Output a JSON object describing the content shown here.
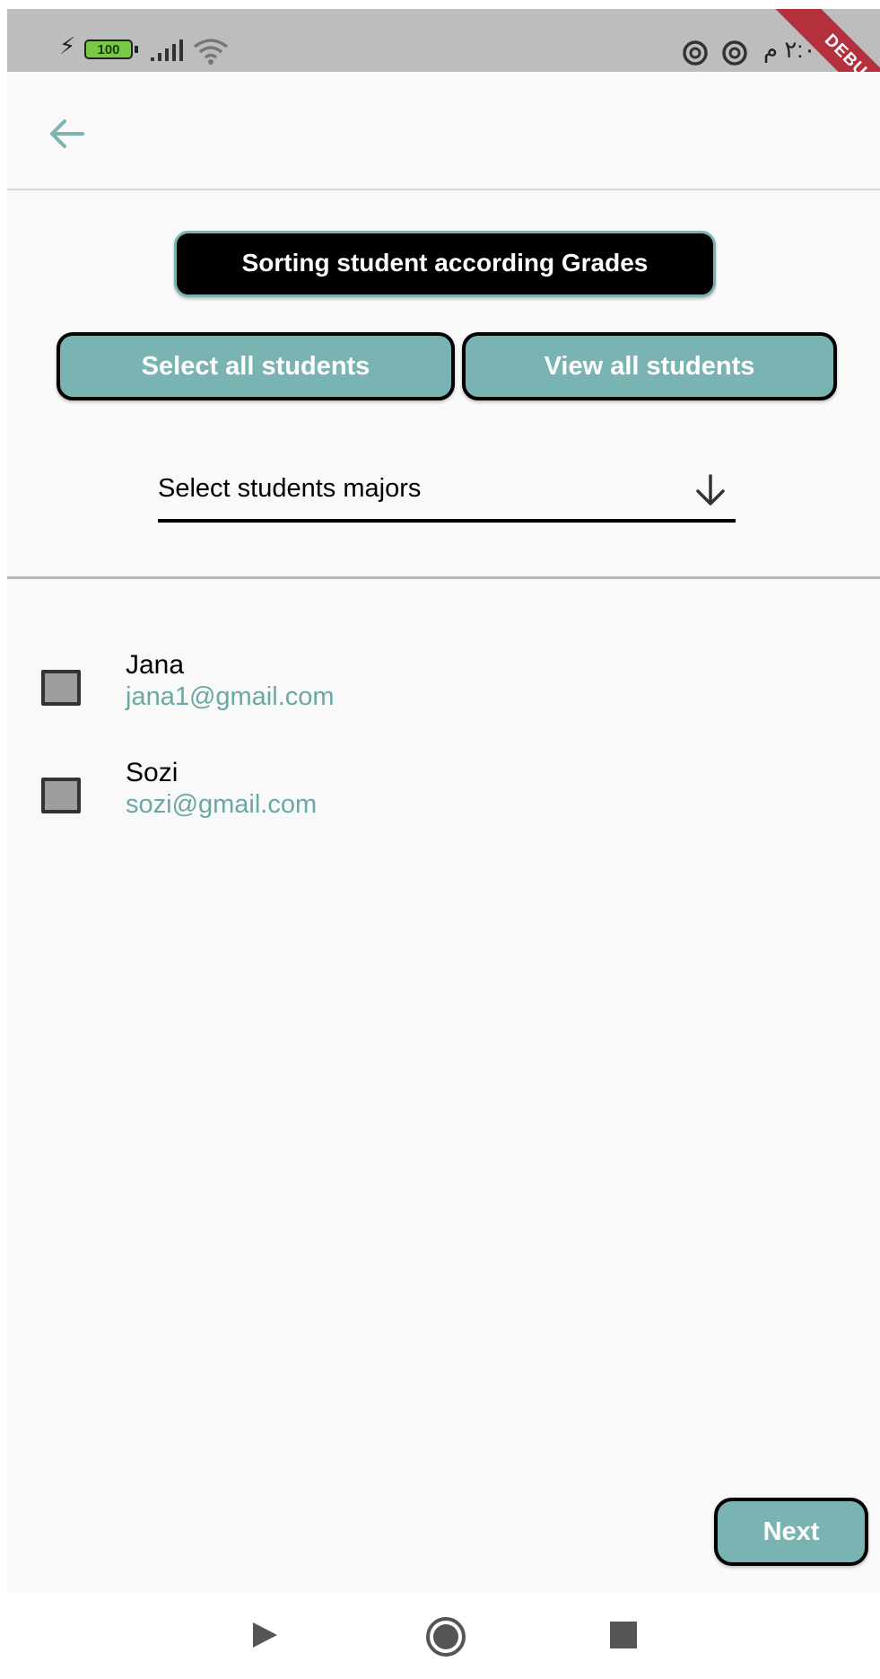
{
  "status_bar": {
    "battery": "100",
    "clock": "٢:٠٩ م",
    "debug_banner": "DEBUG"
  },
  "header": {
    "back_icon": "arrow-left-icon"
  },
  "actions": {
    "sort_label": "Sorting student according Grades",
    "select_all_label": "Select all students",
    "view_all_label": "View all students"
  },
  "majors_dropdown": {
    "label": "Select students majors",
    "icon": "arrow-down-icon"
  },
  "students": [
    {
      "name": "Jana",
      "email": "jana1@gmail.com",
      "checked": false
    },
    {
      "name": "Sozi",
      "email": "sozi@gmail.com",
      "checked": false
    }
  ],
  "footer": {
    "next_label": "Next"
  },
  "colors": {
    "accent": "#7ab4b2",
    "email_text": "#6aa8a6",
    "debug_red": "#b3303c",
    "status_bar_bg": "#bdbdbd"
  }
}
